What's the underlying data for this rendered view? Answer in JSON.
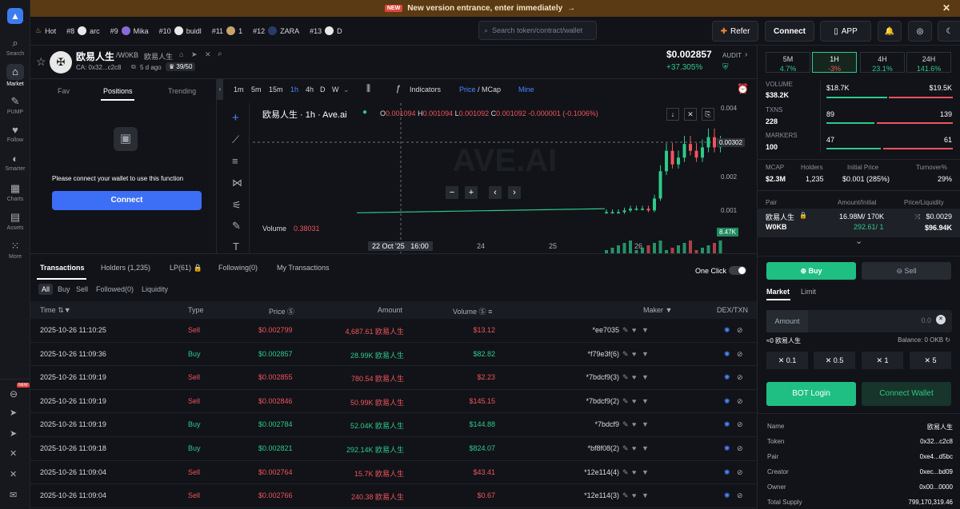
{
  "banner": {
    "badge": "NEW",
    "text": "New version entrance, enter immediately",
    "arrow": "→",
    "close": "✕"
  },
  "sidebar": [
    {
      "label": "Search",
      "icon": "search-icon"
    },
    {
      "label": "Market",
      "icon": "market-icon",
      "active": true
    },
    {
      "label": "PUMP",
      "icon": "pump-icon"
    },
    {
      "label": "Follow",
      "icon": "heart-icon"
    },
    {
      "label": "Smarter",
      "icon": "smarter-icon"
    },
    {
      "label": "Charts",
      "icon": "charts-icon"
    },
    {
      "label": "Assets",
      "icon": "assets-icon"
    },
    {
      "label": "More",
      "icon": "more-icon"
    }
  ],
  "sidebar_bottom_badge": "NEW",
  "topbar": {
    "hot": "Hot",
    "trends": [
      {
        "rank": "#8",
        "name": "arc"
      },
      {
        "rank": "#9",
        "name": "Mika"
      },
      {
        "rank": "#10",
        "name": "buidl"
      },
      {
        "rank": "#11",
        "name": "1"
      },
      {
        "rank": "#12",
        "name": "ZARA"
      },
      {
        "rank": "#13",
        "name": "D"
      }
    ],
    "search_placeholder": "Search token/contract/wallet",
    "refer": "Refer",
    "connect": "Connect",
    "app": "APP"
  },
  "token": {
    "name": "欧易人生",
    "pair": "/W0KB",
    "alias": "欧易人生",
    "ca": "CA: 0x32...c2c8",
    "age": "5 d ago",
    "holders_count": "39/50",
    "price": "$0.002857",
    "change": "+37.305%",
    "audit": "AUDIT"
  },
  "left": {
    "tabs": [
      "Fav",
      "Positions",
      "Trending"
    ],
    "message": "Please connect your wallet to use this function",
    "connect": "Connect"
  },
  "chart": {
    "intervals": [
      "1m",
      "5m",
      "15m",
      "1h",
      "4h",
      "D",
      "W"
    ],
    "indicators": "Indicators",
    "price_mcap_a": "Price",
    "price_mcap_b": "/ MCap",
    "mine": "Mine",
    "title": "欧易人生 · 1h · Ave.ai",
    "ohlc": {
      "o": "0.001094",
      "h": "0.001094",
      "l": "0.001092",
      "c": "0.001092",
      "chg": "-0.000001 (-0.1006%)"
    },
    "watermark": "AVE.AI",
    "volume_label": "Volume",
    "volume_value": "0.38031",
    "y_ticks": [
      "0.004",
      "0.002",
      "0.001"
    ],
    "price_tag": "0.00302",
    "vol_tag": "8.47K",
    "x_ticks": [
      "22 Oct '25",
      "16:00",
      "24",
      "25",
      "26"
    ]
  },
  "chart_data": {
    "type": "candlestick",
    "ytick_labels": [
      "0.004",
      "0.002",
      "0.001"
    ],
    "xtick_labels": [
      "22 Oct '25",
      "16:00",
      "24",
      "25",
      "26"
    ],
    "series": [
      {
        "values": [
          0.001,
          0.001,
          0.001,
          0.00105,
          0.0011,
          0.0011,
          0.0011,
          0.00105,
          0.0014,
          0.0022,
          0.0028,
          0.0024,
          0.0026,
          0.003,
          0.0028,
          0.0026,
          0.0029,
          0.0032,
          0.0029,
          0.003
        ]
      }
    ]
  },
  "bottom": {
    "tabs": [
      "Transactions",
      "Holders (1,235)",
      "LP(61)",
      "Following(0)",
      "My Transactions"
    ],
    "one_click": "One Click",
    "filters": [
      "All",
      "Buy",
      "Sell",
      "Followed(0)",
      "Liquidity"
    ],
    "headers": [
      "Time",
      "Type",
      "Price",
      "Amount",
      "Volume",
      "Maker",
      "DEX/TXN"
    ],
    "rows": [
      {
        "time": "2025-10-26 11:10:25",
        "type": "Sell",
        "price": "$0.002799",
        "amount": "4,687.61 欧易人生",
        "volume": "$13.12",
        "maker": "*ee7035"
      },
      {
        "time": "2025-10-26 11:09:36",
        "type": "Buy",
        "price": "$0.002857",
        "amount": "28.99K 欧易人生",
        "volume": "$82.82",
        "maker": "*f79e3f(6)"
      },
      {
        "time": "2025-10-26 11:09:19",
        "type": "Sell",
        "price": "$0.002855",
        "amount": "780.54 欧易人生",
        "volume": "$2.23",
        "maker": "*7bdcf9(3)"
      },
      {
        "time": "2025-10-26 11:09:19",
        "type": "Sell",
        "price": "$0.002846",
        "amount": "50.99K 欧易人生",
        "volume": "$145.15",
        "maker": "*7bdcf9(2)"
      },
      {
        "time": "2025-10-26 11:09:19",
        "type": "Buy",
        "price": "$0.002784",
        "amount": "52.04K 欧易人生",
        "volume": "$144.88",
        "maker": "*7bdcf9"
      },
      {
        "time": "2025-10-26 11:09:18",
        "type": "Buy",
        "price": "$0.002821",
        "amount": "292.14K 欧易人生",
        "volume": "$824.07",
        "maker": "*bf8f08(2)"
      },
      {
        "time": "2025-10-26 11:09:04",
        "type": "Sell",
        "price": "$0.002764",
        "amount": "15.7K 欧易人生",
        "volume": "$43.41",
        "maker": "*12e114(4)"
      },
      {
        "time": "2025-10-26 11:09:04",
        "type": "Sell",
        "price": "$0.002766",
        "amount": "240.38 欧易人生",
        "volume": "$0.67",
        "maker": "*12e114(3)"
      }
    ]
  },
  "right": {
    "timeframes": [
      {
        "tf": "5M",
        "chg": "4.7%"
      },
      {
        "tf": "1H",
        "chg": "-3%",
        "active": true
      },
      {
        "tf": "4H",
        "chg": "23.1%"
      },
      {
        "tf": "24H",
        "chg": "141.6%"
      }
    ],
    "volume_label": "VOLUME",
    "volume": "$38.2K",
    "vol_buy": "$18.7K",
    "vol_sell": "$19.5K",
    "txns_label": "TXNS",
    "txns": "228",
    "txns_buy": "89",
    "txns_sell": "139",
    "makers_label": "MARKERS",
    "makers": "100",
    "makers_buy": "47",
    "makers_sell": "61",
    "stats": [
      {
        "k": "MCAP",
        "v": "$2.3M"
      },
      {
        "k": "Holders",
        "v": "1,235"
      },
      {
        "k": "Initial Price",
        "v": "$0.001 (285%)"
      },
      {
        "k": "Turnover%",
        "v": "29%"
      }
    ],
    "pair_headers": [
      "Pair",
      "Amount/Initial",
      "Price/Liquidity"
    ],
    "pair": {
      "name": "欧易人生",
      "quote": "W0KB",
      "amount": "16.98M/ 170K",
      "quote_amount": "292.61/ 1",
      "price": "$0.0029",
      "liquidity": "$96.94K"
    },
    "buy": "Buy",
    "sell": "Sell",
    "market": "Market",
    "limit": "Limit",
    "amount_label": "Amount",
    "amount_value": "0.0",
    "approx": "≈0 欧易人生",
    "balance": "Balance: 0 OKB",
    "quick": [
      "0.1",
      "0.5",
      "1",
      "5"
    ],
    "bot_login": "BOT Login",
    "connect_wallet": "Connect Wallet",
    "info": [
      {
        "k": "Name",
        "v": "欧易人生"
      },
      {
        "k": "Token",
        "v": "0x32...c2c8"
      },
      {
        "k": "Pair",
        "v": "0xe4...d5bc"
      },
      {
        "k": "Creator",
        "v": "0xec...bd09"
      },
      {
        "k": "Owner",
        "v": "0x00...0000"
      },
      {
        "k": "Total Supply",
        "v": "799,170,319.46"
      }
    ]
  }
}
